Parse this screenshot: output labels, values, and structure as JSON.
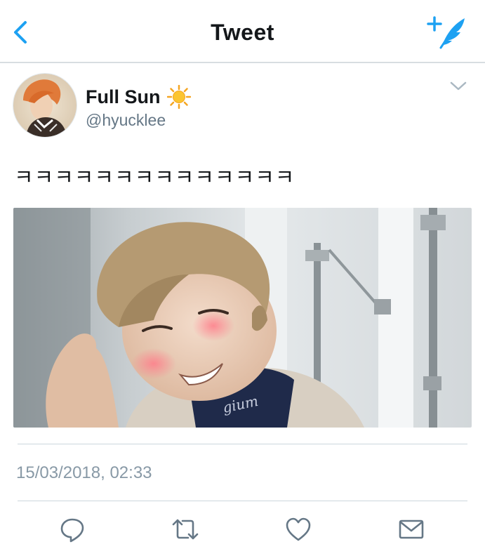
{
  "header": {
    "title": "Tweet",
    "back_icon": "chevron-left-icon",
    "compose_icon": "compose-tweet-icon",
    "accent_color": "#1da1f2"
  },
  "tweet": {
    "display_name": "Full Sun",
    "name_emoji": "sun-emoji",
    "handle": "@hyucklee",
    "text": "ㅋㅋㅋㅋㅋㅋㅋㅋㅋㅋㅋㅋㅋㅋ",
    "timestamp": "15/03/2018, 02:33",
    "menu_icon": "chevron-down-icon",
    "media": "photo"
  },
  "actions": [
    {
      "name": "reply",
      "icon": "reply-icon"
    },
    {
      "name": "retweet",
      "icon": "retweet-icon"
    },
    {
      "name": "like",
      "icon": "heart-icon"
    },
    {
      "name": "share",
      "icon": "mail-icon"
    }
  ],
  "colors": {
    "accent": "#1da1f2",
    "text": "#14171a",
    "secondary": "#657786",
    "divider": "#ccd6dd"
  }
}
